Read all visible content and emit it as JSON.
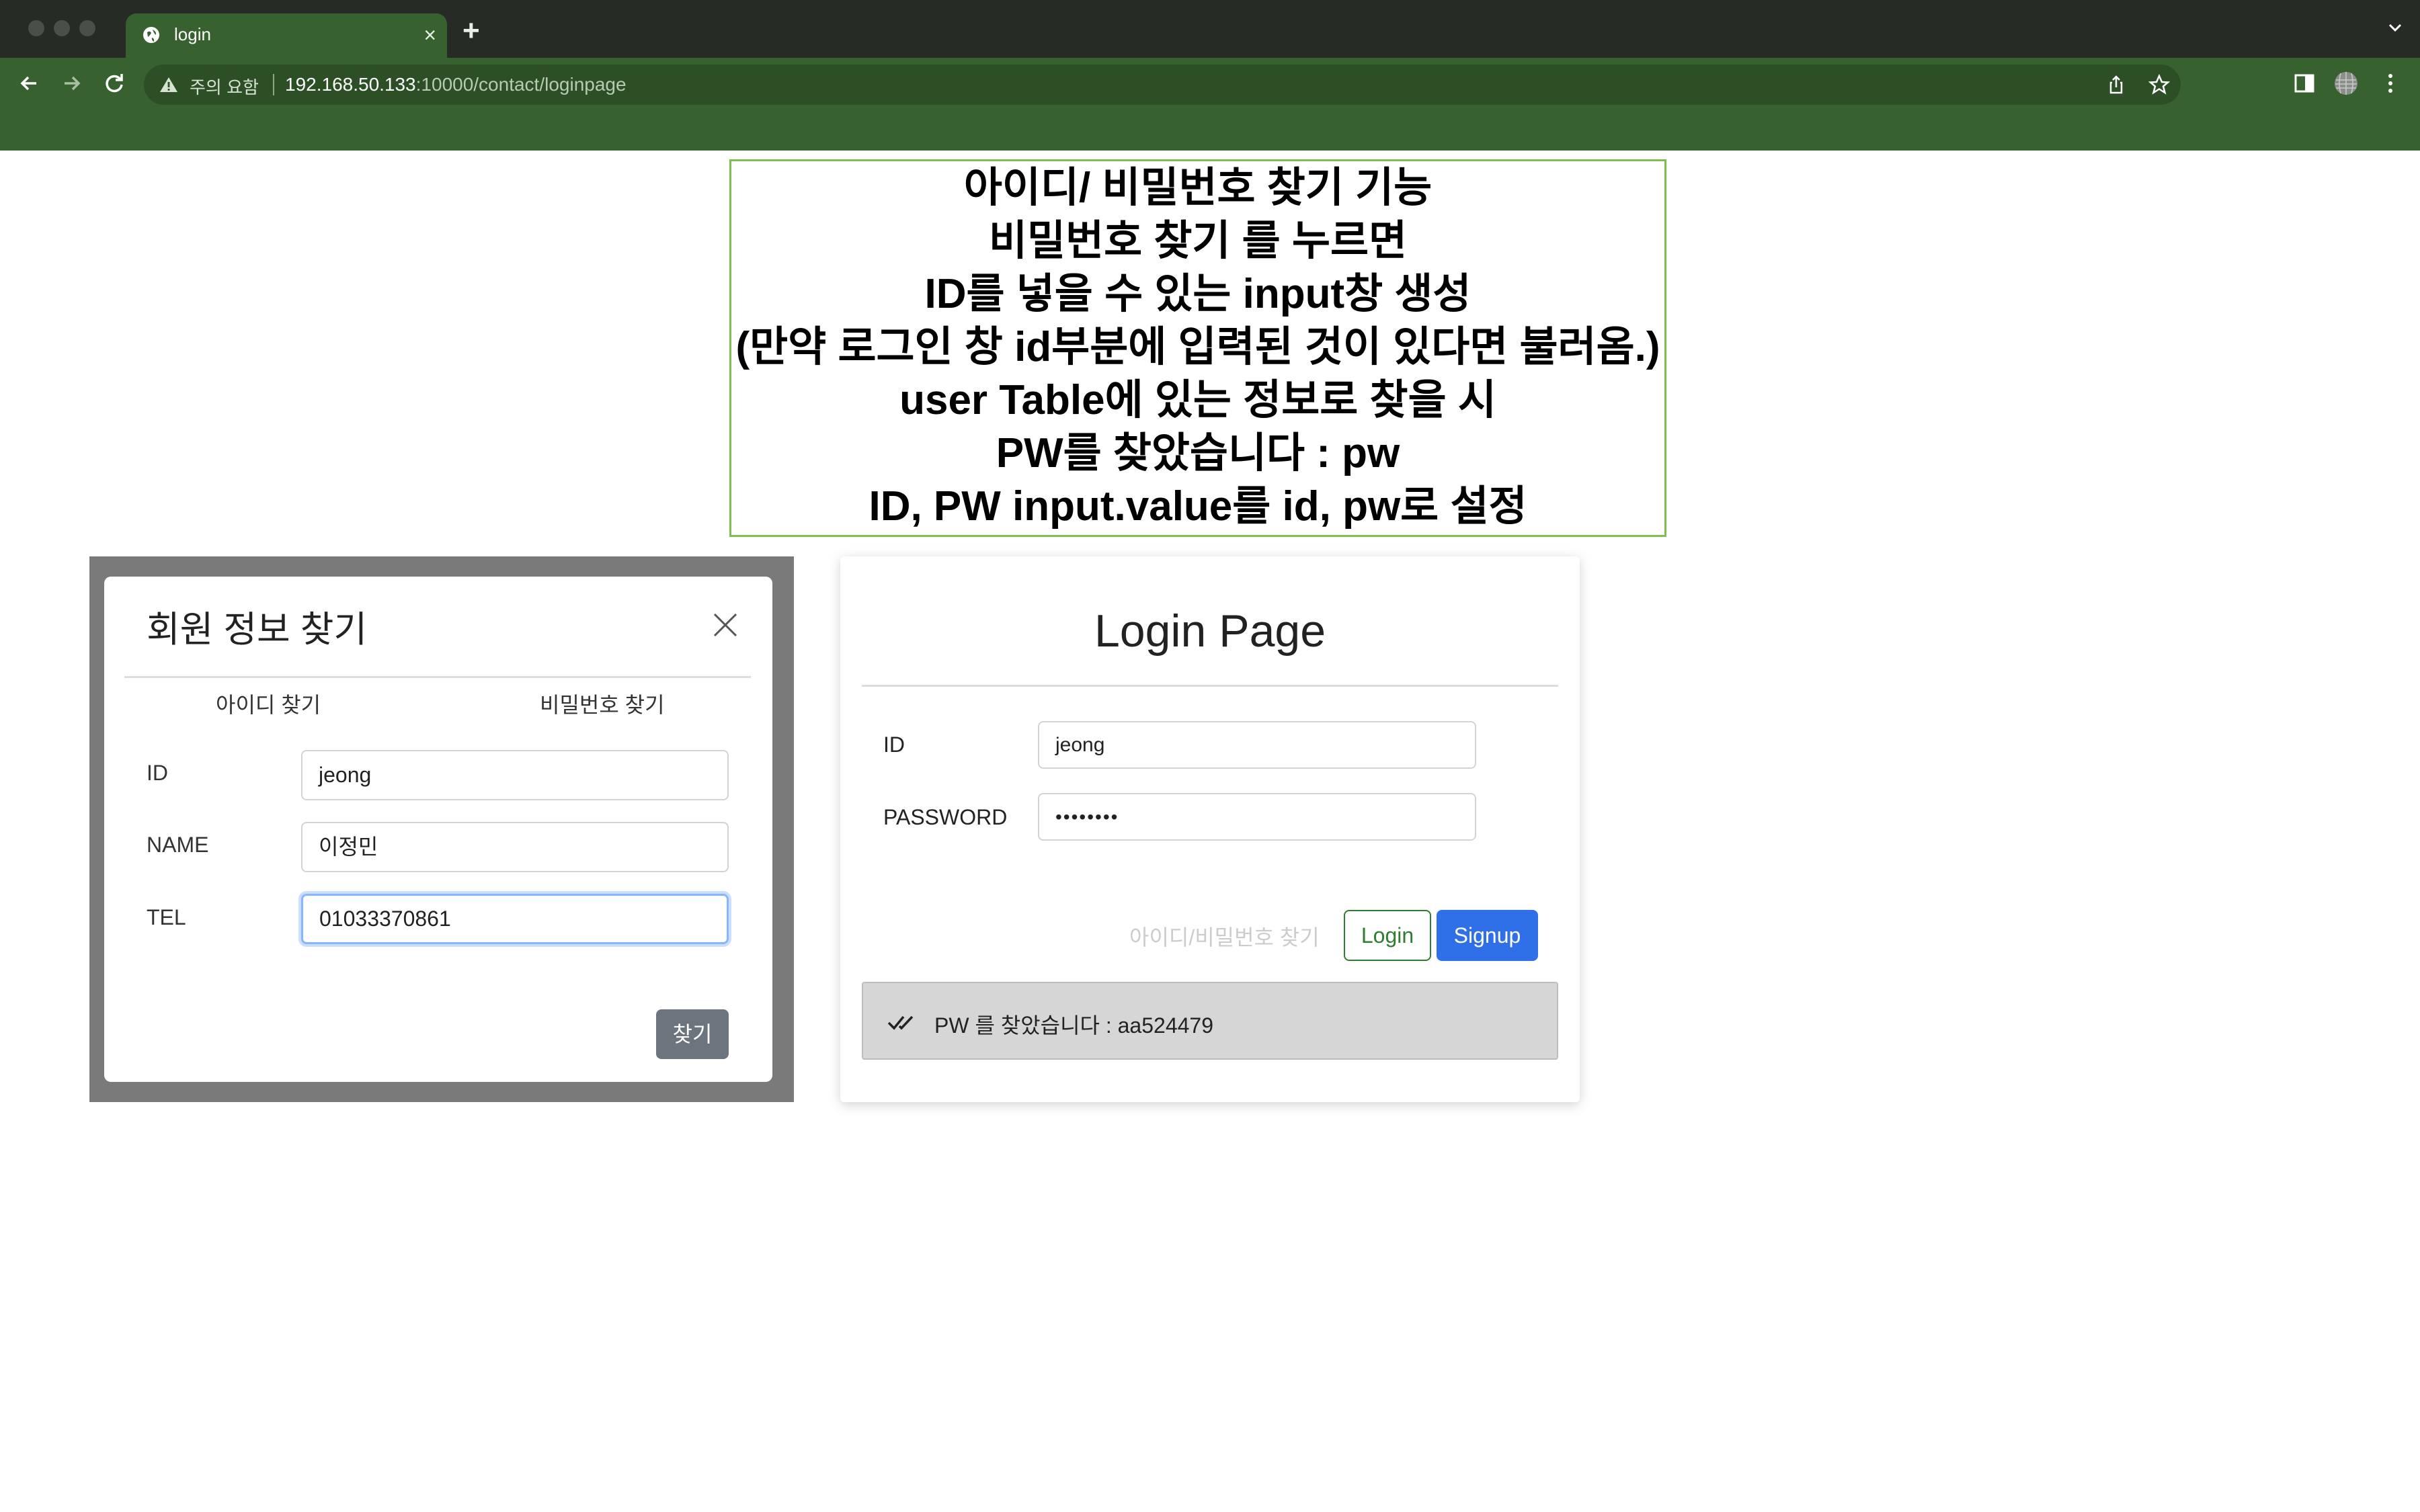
{
  "browser": {
    "tab_title": "login",
    "tab_close": "×",
    "new_tab": "+",
    "security_warning": "주의 요함",
    "url_host": "192.168.50.133",
    "url_rest": ":10000/contact/loginpage"
  },
  "annotation": {
    "lines": [
      "아이디/ 비밀번호 찾기 기능",
      "비밀번호 찾기 를 누르면",
      "ID를 넣을 수 있는 input창 생성",
      "(만약 로그인 창 id부분에 입력된 것이 있다면 불러옴.)",
      "user Table에 있는 정보로 찾을 시",
      "PW를 찾았습니다 : pw",
      "ID, PW input.value를 id, pw로 설정"
    ]
  },
  "modal": {
    "title": "회원 정보 찾기",
    "tabs": [
      "아이디 찾기",
      "비밀번호 찾기"
    ],
    "fields": [
      {
        "label": "ID",
        "value": "jeong"
      },
      {
        "label": "NAME",
        "value": "이정민"
      },
      {
        "label": "TEL",
        "value": "01033370861"
      }
    ],
    "submit_label": "찾기"
  },
  "login": {
    "title": "Login Page",
    "id_label": "ID",
    "id_value": "jeong",
    "password_label": "PASSWORD",
    "password_value": "••••••••",
    "find_link": "아이디/비밀번호 찾기",
    "login_label": "Login",
    "signup_label": "Signup",
    "alert_text": "PW 를 찾았습니다 : aa524479"
  },
  "colors": {
    "chrome_tabbar": "#262b26",
    "chrome_toolbar": "#37622f",
    "annotation_border": "#7fbf4d",
    "signup_blue": "#2f6fe8",
    "login_green": "#2e7d32",
    "find_button_gray": "#6c757d",
    "alert_gray": "#d6d6d6"
  },
  "icons": {
    "tab": "globe-icon",
    "nav": [
      "back-arrow-icon",
      "forward-arrow-icon",
      "reload-icon"
    ],
    "omnibox": [
      "warning-icon",
      "share-icon",
      "star-icon"
    ],
    "toolbar_right": [
      "side-panel-icon",
      "profile-avatar-icon",
      "kebab-menu-icon"
    ],
    "modal_close": "close-icon",
    "alert": "double-check-icon"
  }
}
